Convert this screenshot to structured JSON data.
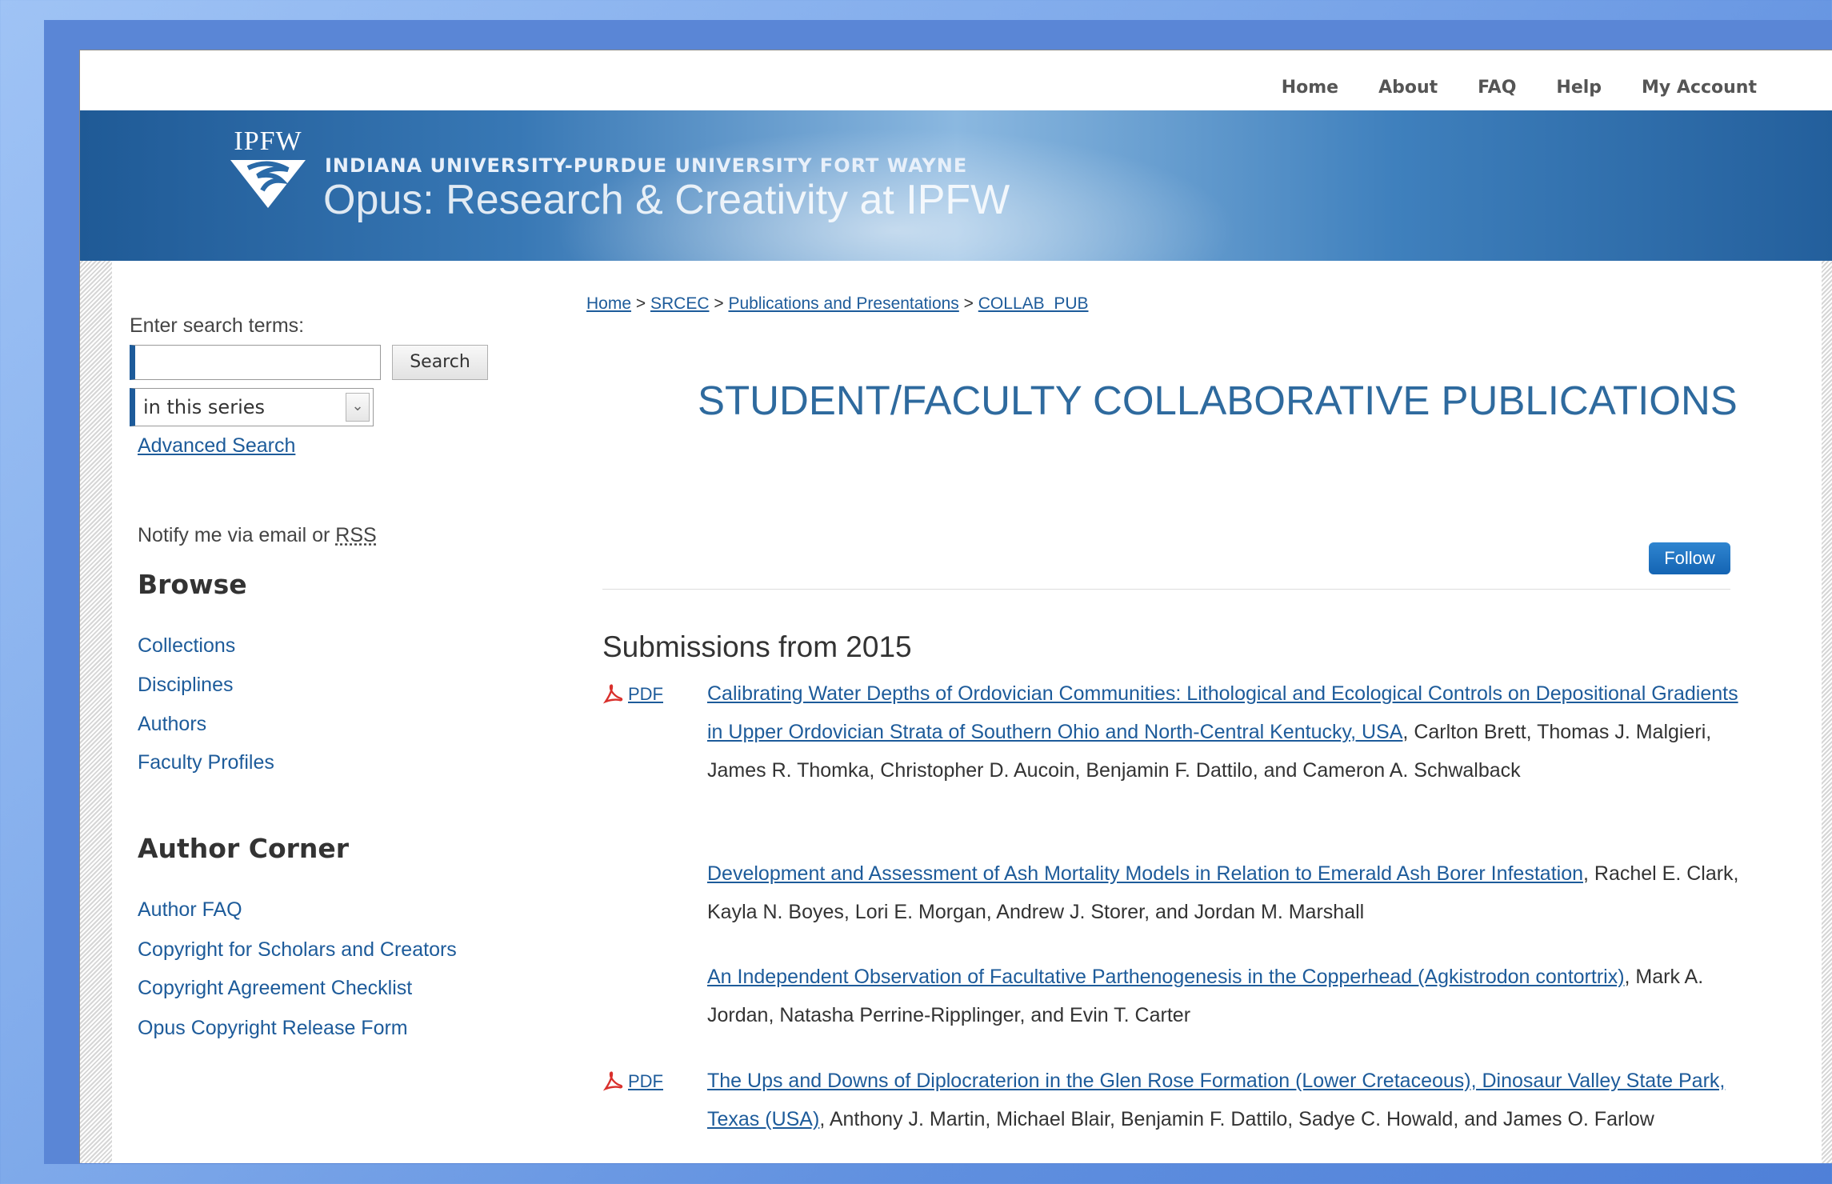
{
  "topnav": [
    "Home",
    "About",
    "FAQ",
    "Help",
    "My Account"
  ],
  "banner": {
    "logo": "IPFW",
    "subtitle": "INDIANA UNIVERSITY-PURDUE UNIVERSITY FORT WAYNE",
    "title": "Opus: Research & Creativity at IPFW"
  },
  "search": {
    "label": "Enter search terms:",
    "button": "Search",
    "input_value": "",
    "scope": "in this series"
  },
  "sidebar": {
    "advanced_search": "Advanced Search",
    "notify_text": "Notify me via email or ",
    "notify_rss": "RSS",
    "browse_heading": "Browse",
    "browse_items": [
      "Collections",
      "Disciplines",
      "Authors",
      "Faculty Profiles"
    ],
    "author_heading": "Author Corner",
    "author_items": [
      "Author FAQ",
      "Copyright for Scholars and Creators",
      "Copyright Agreement Checklist",
      "Opus Copyright Release Form"
    ]
  },
  "breadcrumb": {
    "items": [
      "Home",
      "SRCEC",
      "Publications and Presentations",
      "COLLAB_PUB"
    ],
    "separator": ">"
  },
  "main": {
    "title": "STUDENT/FACULTY COLLABORATIVE PUBLICATIONS",
    "follow": "Follow",
    "section": "Submissions from 2015",
    "pdf_label": "PDF",
    "entries": [
      {
        "title": "Calibrating Water Depths of Ordovician Communities: Lithological and Ecological Controls on Depositional Gradients in Upper Ordovician Strata of Southern Ohio and North-Central Kentucky, USA",
        "authors": ", Carlton Brett, Thomas J. Malgieri, James R. Thomka, Christopher D. Aucoin, Benjamin F. Dattilo, and Cameron A. Schwalback",
        "has_pdf": true
      },
      {
        "title": "Development and Assessment of Ash Mortality Models in Relation to Emerald Ash Borer Infestation",
        "authors": ", Rachel E. Clark, Kayla N. Boyes, Lori E. Morgan, Andrew J. Storer, and Jordan M. Marshall",
        "has_pdf": false
      },
      {
        "title": "An Independent Observation of Facultative Parthenogenesis in the Copperhead (Agkistrodon contortrix)",
        "authors": ", Mark A. Jordan, Natasha Perrine-Ripplinger, and Evin T. Carter",
        "has_pdf": false
      },
      {
        "title": "The Ups and Downs of Diplocraterion in the Glen Rose Formation (Lower Cretaceous), Dinosaur Valley State Park, Texas (USA)",
        "authors": ", Anthony J. Martin, Michael Blair, Benjamin F. Dattilo, Sadye C. Howald, and James O. Farlow",
        "has_pdf": true
      }
    ]
  },
  "colors": {
    "link": "#1d5b9a",
    "title": "#2e6a9e",
    "banner": "#2a6aa8",
    "follow": "#1a6dbf"
  }
}
